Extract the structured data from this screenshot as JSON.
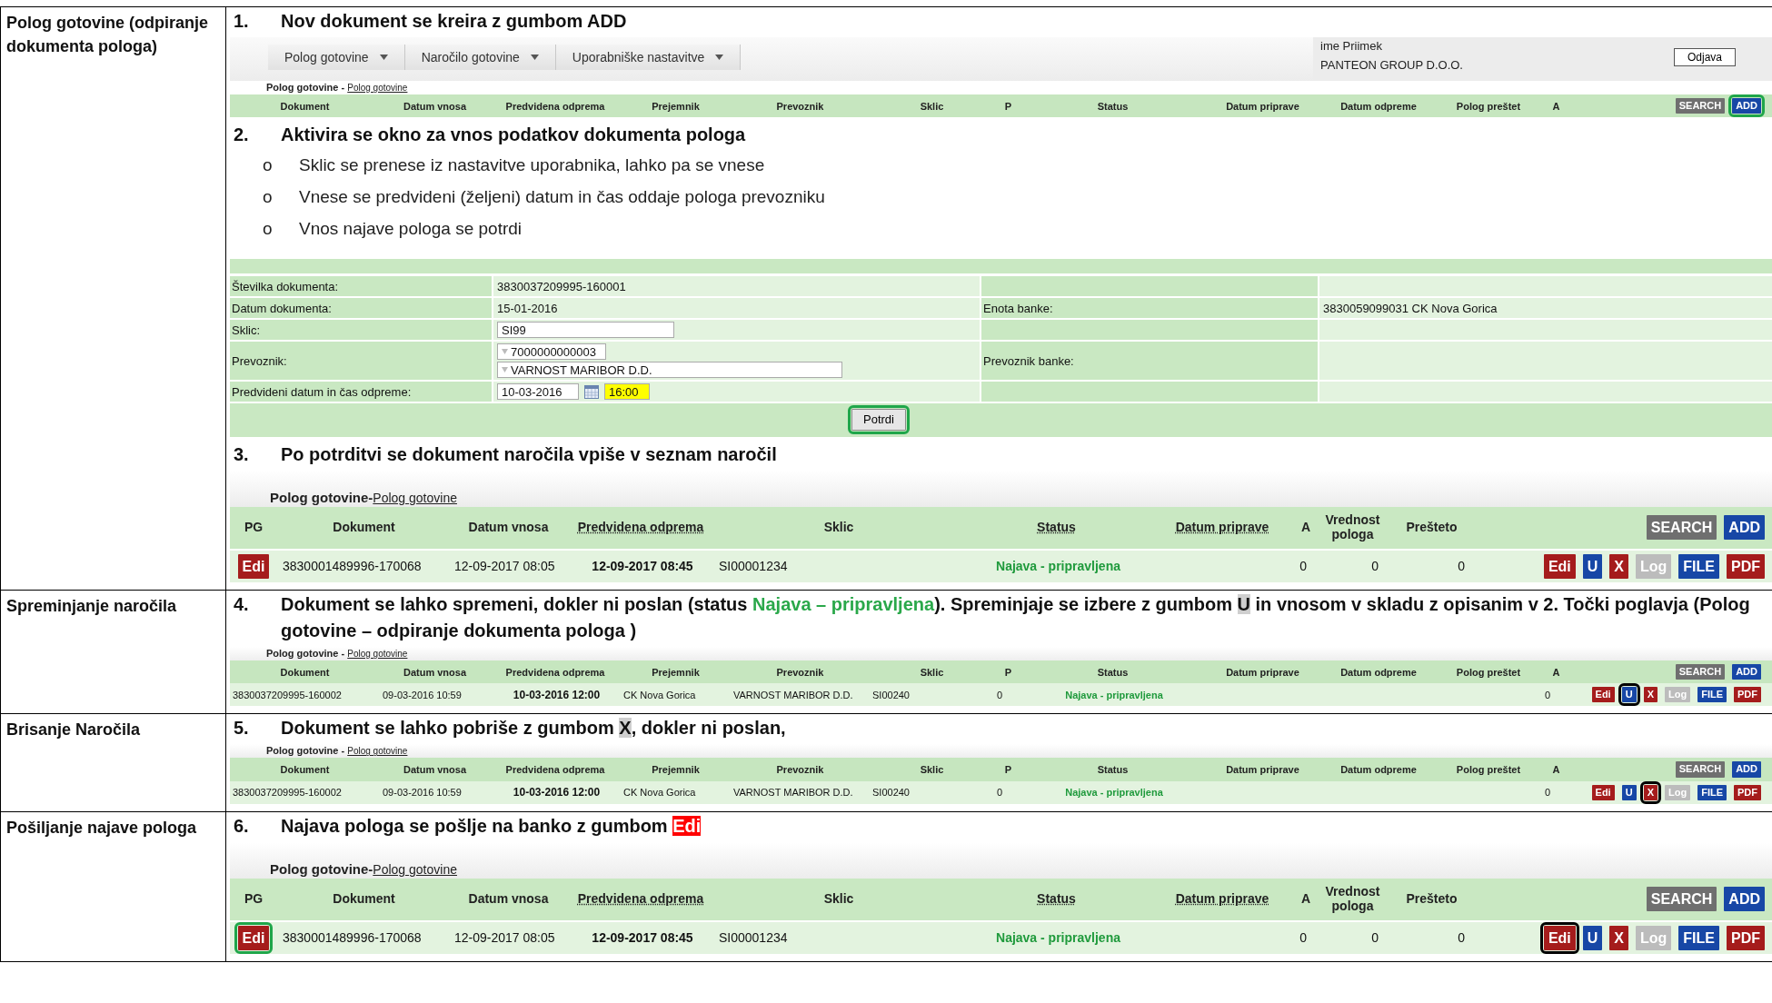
{
  "sections": [
    {
      "label": "Polog gotovine (odpiranje dokumenta pologa)",
      "blocks": [
        {
          "kind": "step",
          "number": "1.",
          "parts": [
            {
              "kind": "plain",
              "text": "Nov dokument se kreira z gumbom ADD"
            }
          ]
        },
        {
          "kind": "app_header",
          "menus": [
            "Polog gotovine",
            "Naročilo gotovine",
            "Uporabniške nastavitve"
          ],
          "user": "ime Priimek",
          "company": "PANTEON GROUP D.O.O.",
          "logout": "Odjava",
          "breadcrumb": {
            "title": "Polog gotovine",
            "separator": "-",
            "link": "Polog gotovine"
          },
          "columns": [
            "Dokument",
            "Datum vnosa",
            "Predvidena odprema",
            "Prejemnik",
            "Prevoznik",
            "Sklic",
            "P",
            "Status",
            "Datum priprave",
            "Datum odpreme",
            "Polog preštet",
            "A"
          ],
          "buttons": [
            {
              "label": "SEARCH",
              "kind": "search",
              "highlighted": false
            },
            {
              "label": "ADD",
              "kind": "add",
              "highlighted": true,
              "color": "#1fa64a"
            }
          ]
        },
        {
          "kind": "step",
          "number": "2.",
          "parts": [
            {
              "kind": "plain",
              "text": "Aktivira se okno za vnos podatkov dokumenta pologa"
            }
          ]
        },
        {
          "kind": "bullets",
          "items": [
            {
              "marker": "o",
              "text": "Sklic se prenese iz nastavitve uporabnika, lahko pa se vnese"
            },
            {
              "marker": "o",
              "text": "Vnese se predvideni (željeni)  datum in čas oddaje pologa prevozniku"
            },
            {
              "marker": "o",
              "text": "Vnos najave pologa se potrdi"
            }
          ]
        },
        {
          "kind": "form",
          "rows": [
            {
              "label": "Številka dokumenta:",
              "fields": [
                {
                  "kind": "text",
                  "value": "3830037209995-160001"
                }
              ]
            },
            {
              "label": "Datum dokumenta:",
              "fields": [
                {
                  "kind": "text",
                  "value": "15-01-2016"
                }
              ],
              "side_label": "Enota banke:",
              "side_value": "3830059099031 CK Nova Gorica"
            },
            {
              "label": "Sklic:",
              "fields": [
                {
                  "kind": "input",
                  "value": "SI99"
                }
              ]
            },
            {
              "label": "Prevoznik:",
              "fields": [
                {
                  "kind": "lookup",
                  "value": "7000000000003"
                },
                {
                  "kind": "lookup",
                  "value": "VARNOST MARIBOR D.D."
                }
              ],
              "side_label": "Prevoznik banke:"
            },
            {
              "label": "Predvideni datum in čas odpreme:",
              "fields": [
                {
                  "kind": "date",
                  "value": "10-03-2016"
                },
                {
                  "kind": "time",
                  "value": "16:00",
                  "highlighted": true
                }
              ]
            }
          ],
          "submit": {
            "label": "Potrdi",
            "kind": "submit",
            "highlighted": true,
            "color": "#1fa64a"
          }
        },
        {
          "kind": "step",
          "number": "3.",
          "parts": [
            {
              "kind": "plain",
              "text": "Po potrditvi se dokument naročila vpiše v seznam naročil"
            }
          ]
        },
        {
          "kind": "grid_large",
          "breadcrumb": {
            "title": "Polog gotovine",
            "separator": "-",
            "link": "Polog gotovine"
          },
          "columns": [
            {
              "label": "PG",
              "link": false
            },
            {
              "label": "Dokument",
              "link": false
            },
            {
              "label": "Datum vnosa",
              "link": false
            },
            {
              "label": "Predvidena odprema",
              "link": true
            },
            {
              "label": "Sklic",
              "link": false
            },
            {
              "label": "Status",
              "link": true
            },
            {
              "label": "Datum priprave",
              "link": true
            },
            {
              "label": "A",
              "link": false
            },
            {
              "label": "Vrednost pologa",
              "link": false
            },
            {
              "label": "Prešteto",
              "link": false
            }
          ],
          "buttons": [
            {
              "label": "SEARCH",
              "kind": "search",
              "highlighted": false
            },
            {
              "label": "ADD",
              "kind": "add",
              "highlighted": false
            }
          ],
          "rows": [
            {
              "cells": [
                {
                  "kind": "button",
                  "button": {
                    "label": "Edi",
                    "kind": "edi",
                    "highlighted": false
                  }
                },
                {
                  "kind": "plain",
                  "text": "3830001489996-170068"
                },
                {
                  "kind": "plain",
                  "text": "12-09-2017 08:05"
                },
                {
                  "kind": "emphasis",
                  "text": "12-09-2017 08:45"
                },
                {
                  "kind": "plain",
                  "text": "SI00001234"
                },
                {
                  "kind": "status",
                  "text": "Najava - pripravljena"
                },
                {
                  "kind": "empty"
                },
                {
                  "kind": "number",
                  "text": "0"
                },
                {
                  "kind": "number",
                  "text": "0"
                },
                {
                  "kind": "number",
                  "text": "0"
                }
              ],
              "actions": [
                {
                  "label": "Edi",
                  "kind": "edi",
                  "highlighted": false
                },
                {
                  "label": "U",
                  "kind": "update",
                  "highlighted": false
                },
                {
                  "label": "X",
                  "kind": "delete",
                  "highlighted": false
                },
                {
                  "label": "Log",
                  "kind": "log",
                  "highlighted": false
                },
                {
                  "label": "FILE",
                  "kind": "file",
                  "highlighted": false
                },
                {
                  "label": "PDF",
                  "kind": "pdf",
                  "highlighted": false
                }
              ]
            }
          ]
        }
      ]
    },
    {
      "label": "Spreminjanje naročila",
      "blocks": [
        {
          "kind": "step",
          "number": "4.",
          "parts": [
            {
              "kind": "plain",
              "text": "Dokument se lahko spremeni, dokler ni poslan  (status "
            },
            {
              "kind": "status",
              "text": "Najava – pripravljena"
            },
            {
              "kind": "plain",
              "text": "). Spreminjaje se izbere z gumbom "
            },
            {
              "kind": "key",
              "text": "U"
            },
            {
              "kind": "plain",
              "text": " in vnosom v skladu z opisanim v 2. Točki poglavja (Polog gotovine – odpiranje dokumenta pologa )"
            }
          ]
        },
        {
          "kind": "grid_compact",
          "breadcrumb": {
            "title": "Polog gotovine",
            "separator": "-",
            "link": "Polog gotovine"
          },
          "columns": [
            "Dokument",
            "Datum vnosa",
            "Predvidena odprema",
            "Prejemnik",
            "Prevoznik",
            "Sklic",
            "P",
            "Status",
            "Datum priprave",
            "Datum odpreme",
            "Polog preštet",
            "A"
          ],
          "buttons": [
            {
              "label": "SEARCH",
              "kind": "search",
              "highlighted": false
            },
            {
              "label": "ADD",
              "kind": "add",
              "highlighted": false
            }
          ],
          "rows": [
            {
              "cells": [
                {
                  "kind": "plain",
                  "text": "3830037209995-160002"
                },
                {
                  "kind": "plain",
                  "text": "09-03-2016 10:59"
                },
                {
                  "kind": "emphasis",
                  "text": "10-03-2016 12:00"
                },
                {
                  "kind": "plain",
                  "text": "CK Nova Gorica"
                },
                {
                  "kind": "plain",
                  "text": "VARNOST MARIBOR D.D."
                },
                {
                  "kind": "plain",
                  "text": "SI00240"
                },
                {
                  "kind": "number",
                  "text": "0"
                },
                {
                  "kind": "status",
                  "text": "Najava - pripravljena"
                },
                {
                  "kind": "empty"
                },
                {
                  "kind": "empty"
                },
                {
                  "kind": "empty"
                },
                {
                  "kind": "number",
                  "text": "0"
                }
              ],
              "actions": [
                {
                  "label": "Edi",
                  "kind": "edi",
                  "highlighted": false
                },
                {
                  "label": "U",
                  "kind": "update",
                  "highlighted": true,
                  "color": "#000000"
                },
                {
                  "label": "X",
                  "kind": "delete",
                  "highlighted": false
                },
                {
                  "label": "Log",
                  "kind": "log",
                  "highlighted": false
                },
                {
                  "label": "FILE",
                  "kind": "file",
                  "highlighted": false
                },
                {
                  "label": "PDF",
                  "kind": "pdf",
                  "highlighted": false
                }
              ]
            }
          ]
        }
      ]
    },
    {
      "label": "Brisanje Naročila",
      "blocks": [
        {
          "kind": "step",
          "number": "5.",
          "parts": [
            {
              "kind": "plain",
              "text": "Dokument se lahko pobriše z gumbom "
            },
            {
              "kind": "key",
              "text": "X"
            },
            {
              "kind": "plain",
              "text": ", dokler ni poslan,"
            }
          ]
        },
        {
          "kind": "grid_compact",
          "breadcrumb": {
            "title": "Polog gotovine",
            "separator": "-",
            "link": "Polog gotovine"
          },
          "columns": [
            "Dokument",
            "Datum vnosa",
            "Predvidena odprema",
            "Prejemnik",
            "Prevoznik",
            "Sklic",
            "P",
            "Status",
            "Datum priprave",
            "Datum odpreme",
            "Polog preštet",
            "A"
          ],
          "buttons": [
            {
              "label": "SEARCH",
              "kind": "search",
              "highlighted": false
            },
            {
              "label": "ADD",
              "kind": "add",
              "highlighted": false
            }
          ],
          "rows": [
            {
              "cells": [
                {
                  "kind": "plain",
                  "text": "3830037209995-160002"
                },
                {
                  "kind": "plain",
                  "text": "09-03-2016 10:59"
                },
                {
                  "kind": "emphasis",
                  "text": "10-03-2016 12:00"
                },
                {
                  "kind": "plain",
                  "text": "CK Nova Gorica"
                },
                {
                  "kind": "plain",
                  "text": "VARNOST MARIBOR D.D."
                },
                {
                  "kind": "plain",
                  "text": "SI00240"
                },
                {
                  "kind": "number",
                  "text": "0"
                },
                {
                  "kind": "status",
                  "text": "Najava - pripravljena"
                },
                {
                  "kind": "empty"
                },
                {
                  "kind": "empty"
                },
                {
                  "kind": "empty"
                },
                {
                  "kind": "number",
                  "text": "0"
                }
              ],
              "actions": [
                {
                  "label": "Edi",
                  "kind": "edi",
                  "highlighted": false
                },
                {
                  "label": "U",
                  "kind": "update",
                  "highlighted": false
                },
                {
                  "label": "X",
                  "kind": "delete",
                  "highlighted": true,
                  "color": "#000000"
                },
                {
                  "label": "Log",
                  "kind": "log",
                  "highlighted": false
                },
                {
                  "label": "FILE",
                  "kind": "file",
                  "highlighted": false
                },
                {
                  "label": "PDF",
                  "kind": "pdf",
                  "highlighted": false
                }
              ]
            }
          ]
        }
      ]
    },
    {
      "label": "Pošiljanje najave pologa",
      "blocks": [
        {
          "kind": "step",
          "number": "6.",
          "parts": [
            {
              "kind": "plain",
              "text": "Najava pologa se pošlje na banko z gumbom "
            },
            {
              "kind": "danger",
              "text": "Edi"
            }
          ]
        },
        {
          "kind": "grid_large",
          "breadcrumb": {
            "title": "Polog gotovine",
            "separator": "-",
            "link": "Polog gotovine"
          },
          "columns": [
            {
              "label": "PG",
              "link": false
            },
            {
              "label": "Dokument",
              "link": false
            },
            {
              "label": "Datum vnosa",
              "link": false
            },
            {
              "label": "Predvidena odprema",
              "link": true
            },
            {
              "label": "Sklic",
              "link": false
            },
            {
              "label": "Status",
              "link": true
            },
            {
              "label": "Datum priprave",
              "link": true
            },
            {
              "label": "A",
              "link": false
            },
            {
              "label": "Vrednost pologa",
              "link": false
            },
            {
              "label": "Prešteto",
              "link": false
            }
          ],
          "buttons": [
            {
              "label": "SEARCH",
              "kind": "search",
              "highlighted": false
            },
            {
              "label": "ADD",
              "kind": "add",
              "highlighted": false
            }
          ],
          "rows": [
            {
              "cells": [
                {
                  "kind": "button",
                  "button": {
                    "label": "Edi",
                    "kind": "edi",
                    "highlighted": true,
                    "color": "#1fa64a"
                  }
                },
                {
                  "kind": "plain",
                  "text": "3830001489996-170068"
                },
                {
                  "kind": "plain",
                  "text": "12-09-2017 08:05"
                },
                {
                  "kind": "emphasis",
                  "text": "12-09-2017 08:45"
                },
                {
                  "kind": "plain",
                  "text": "SI00001234"
                },
                {
                  "kind": "status",
                  "text": "Najava - pripravljena"
                },
                {
                  "kind": "empty"
                },
                {
                  "kind": "number",
                  "text": "0"
                },
                {
                  "kind": "number",
                  "text": "0"
                },
                {
                  "kind": "number",
                  "text": "0"
                }
              ],
              "actions": [
                {
                  "label": "Edi",
                  "kind": "edi",
                  "highlighted": true,
                  "color": "#000000"
                },
                {
                  "label": "U",
                  "kind": "update",
                  "highlighted": false
                },
                {
                  "label": "X",
                  "kind": "delete",
                  "highlighted": false
                },
                {
                  "label": "Log",
                  "kind": "log",
                  "highlighted": false
                },
                {
                  "label": "FILE",
                  "kind": "file",
                  "highlighted": false
                },
                {
                  "label": "PDF",
                  "kind": "pdf",
                  "highlighted": false
                }
              ]
            }
          ]
        }
      ]
    }
  ]
}
